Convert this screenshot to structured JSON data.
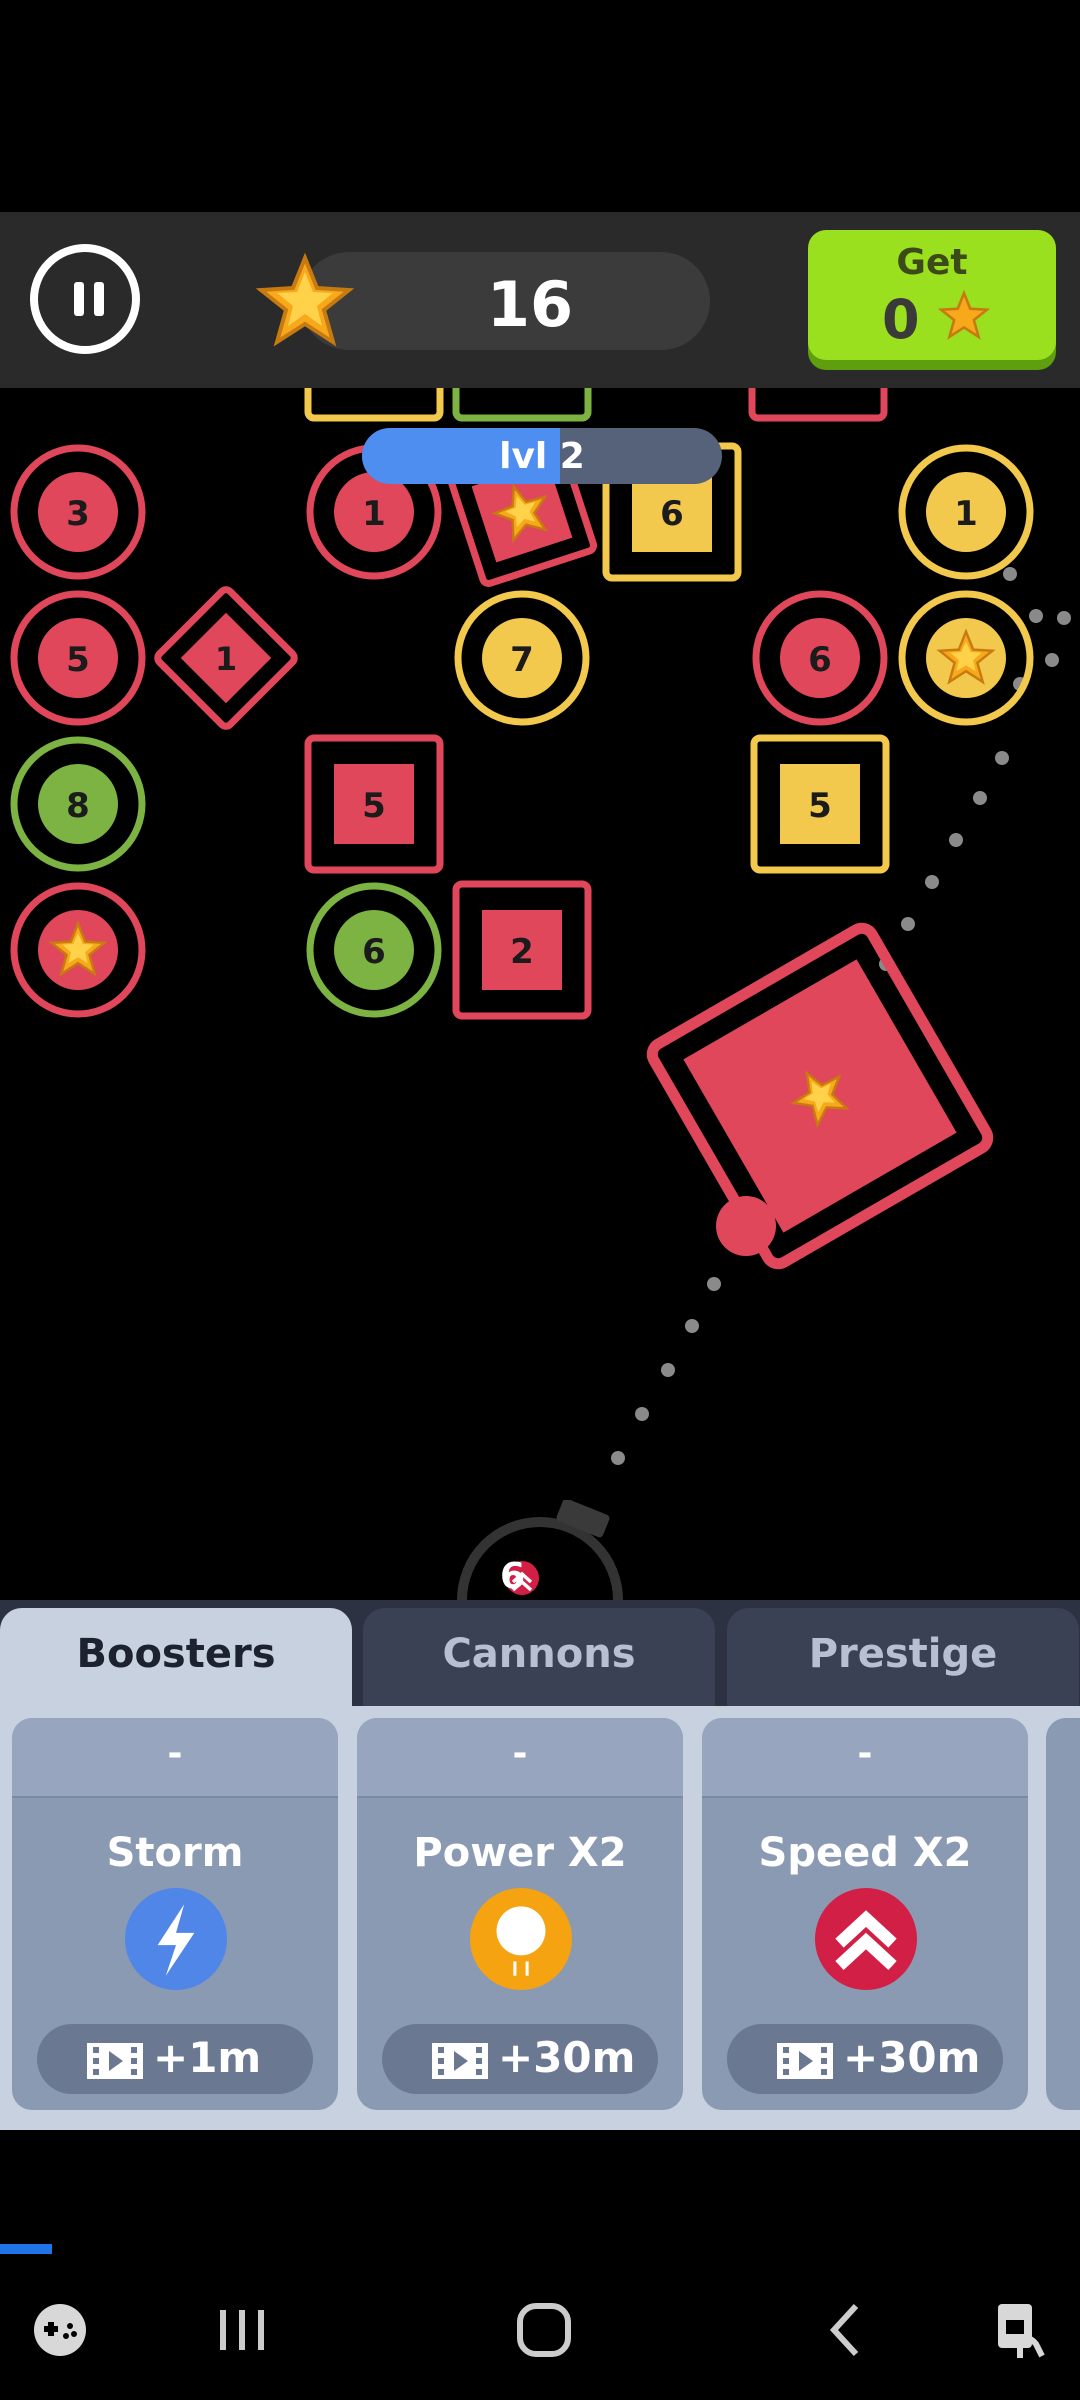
{
  "hud": {
    "score": "16",
    "get_label": "Get",
    "get_value": "0"
  },
  "level": {
    "label": "lvl 2",
    "progress": 0.55
  },
  "board": {
    "blocks": [
      {
        "shape": "circle",
        "color": "red",
        "label": "3"
      },
      {
        "shape": "circle",
        "color": "red",
        "label": "1"
      },
      {
        "shape": "diamond",
        "color": "red",
        "label": "star"
      },
      {
        "shape": "square",
        "color": "yellow",
        "label": "6"
      },
      {
        "shape": "circle",
        "color": "yellow",
        "label": "1"
      },
      {
        "shape": "circle",
        "color": "red",
        "label": "5"
      },
      {
        "shape": "diamond",
        "color": "red",
        "label": "1"
      },
      {
        "shape": "circle",
        "color": "yellow",
        "label": "7"
      },
      {
        "shape": "circle",
        "color": "red",
        "label": "6"
      },
      {
        "shape": "circle",
        "color": "yellow",
        "label": "star"
      },
      {
        "shape": "circle",
        "color": "green",
        "label": "8"
      },
      {
        "shape": "square",
        "color": "red",
        "label": "5"
      },
      {
        "shape": "square",
        "color": "yellow",
        "label": "5"
      },
      {
        "shape": "circle",
        "color": "red",
        "label": "star"
      },
      {
        "shape": "circle",
        "color": "green",
        "label": "6"
      },
      {
        "shape": "square",
        "color": "red",
        "label": "2"
      },
      {
        "shape": "diamond",
        "color": "red",
        "label": "star"
      }
    ],
    "colors": {
      "red": "#e0475a",
      "yellow": "#f2c94c",
      "green": "#7cb342"
    }
  },
  "cannon": {
    "count": "6"
  },
  "tabs": [
    {
      "label": "Boosters",
      "active": true
    },
    {
      "label": "Cannons",
      "active": false
    },
    {
      "label": "Prestige",
      "active": false
    }
  ],
  "boosters": [
    {
      "top": "-",
      "name": "Storm",
      "icon": "lightning-icon",
      "reward": "+1m",
      "color": "#4f86e8"
    },
    {
      "top": "-",
      "name": "Power X2",
      "icon": "power-ball-icon",
      "reward": "+30m",
      "color": "#f5a310"
    },
    {
      "top": "-",
      "name": "Speed X2",
      "icon": "speed-chevrons-icon",
      "reward": "+30m",
      "color": "#d21f45"
    }
  ]
}
